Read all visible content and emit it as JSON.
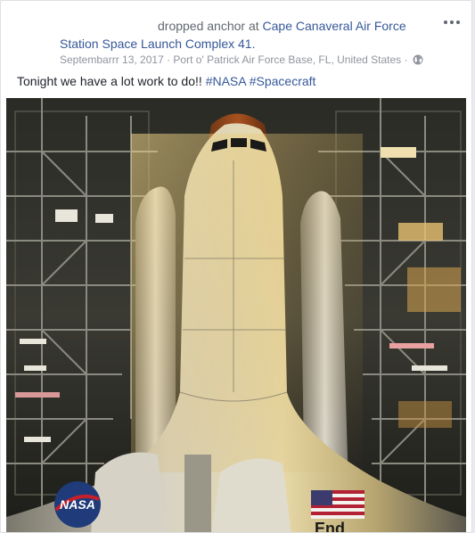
{
  "post": {
    "action_text": "dropped anchor at",
    "place_part1": "Cape Canaveral Air Force",
    "place_part2": "Station Space Launch Complex 41.",
    "date": "Septembarrr 13, 2017",
    "separator": " · ",
    "location": "Port o' Patrick Air Force Base, FL, United States",
    "separator2": " · ",
    "privacy_icon": "globe-icon",
    "more_icon": "more-options-icon",
    "text": "Tonight we have a lot work to do!! ",
    "hashtags": [
      "#NASA",
      "#Spacecraft"
    ],
    "photo": {
      "logo_text": "NASA",
      "orbiter_text": "End"
    }
  },
  "colors": {
    "link": "#365899",
    "meta": "#90949c",
    "text": "#1d2129"
  }
}
